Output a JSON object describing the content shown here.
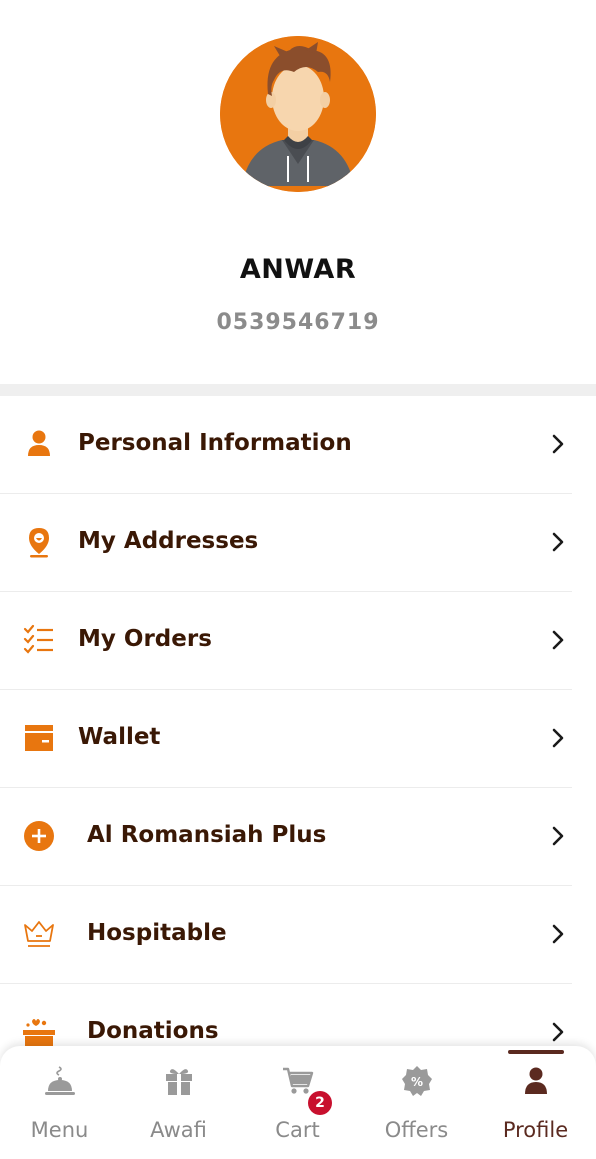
{
  "profile": {
    "name": "ANWAR",
    "phone": "0539546719",
    "avatar_bg": "#e8760f"
  },
  "menu": {
    "items": [
      {
        "label": "Personal Information",
        "icon": "person-icon"
      },
      {
        "label": "My Addresses",
        "icon": "location-pin-icon"
      },
      {
        "label": "My Orders",
        "icon": "checklist-icon"
      },
      {
        "label": "Wallet",
        "icon": "wallet-icon"
      },
      {
        "label": "Al Romansiah Plus",
        "icon": "plus-circle-icon"
      },
      {
        "label": "Hospitable",
        "icon": "crown-icon"
      },
      {
        "label": "Donations",
        "icon": "donation-box-icon"
      }
    ],
    "accent_color": "#e8760f",
    "label_color": "#3a1805"
  },
  "bottom_nav": {
    "items": [
      {
        "label": "Menu",
        "icon": "food-cloche-icon"
      },
      {
        "label": "Awafi",
        "icon": "gift-icon"
      },
      {
        "label": "Cart",
        "icon": "cart-icon",
        "badge": "2"
      },
      {
        "label": "Offers",
        "icon": "discount-badge-icon"
      },
      {
        "label": "Profile",
        "icon": "profile-icon",
        "active": true
      }
    ],
    "active_color": "#5b2a20",
    "inactive_color": "#8a8a8a",
    "badge_color": "#c8102e"
  }
}
